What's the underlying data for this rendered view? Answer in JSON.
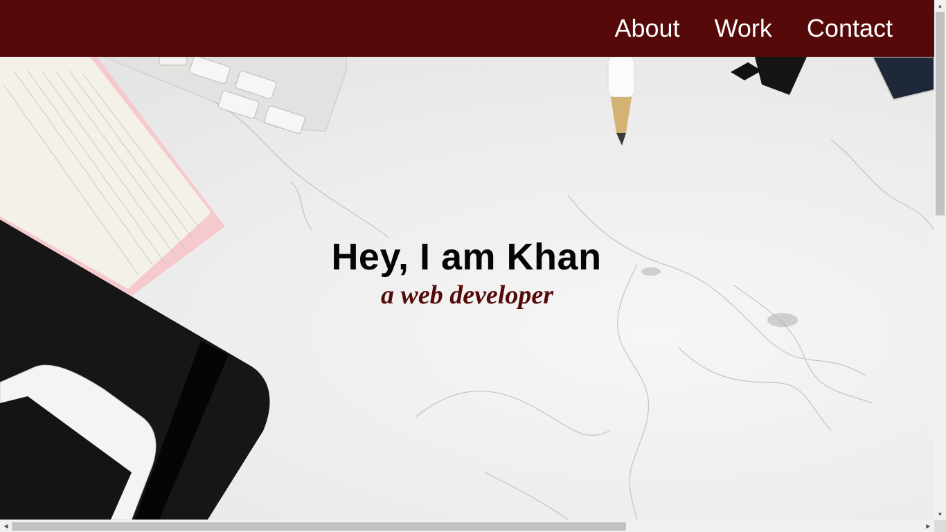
{
  "nav": {
    "links": [
      {
        "label": "About"
      },
      {
        "label": "Work"
      },
      {
        "label": "Contact"
      }
    ]
  },
  "hero": {
    "title": "Hey, I am Khan",
    "subtitle": "a web developer",
    "background": "marble desk with keyboard, notebook, pen, phone and planner"
  },
  "colors": {
    "nav_bg": "#550909",
    "nav_text": "#ffffff",
    "title": "#050505",
    "subtitle": "#550909"
  },
  "scrollbars": {
    "vertical": {
      "position_fraction": 0.0,
      "visible_fraction": 0.42
    },
    "horizontal": {
      "position_fraction": 0.0,
      "visible_fraction": 0.67
    }
  },
  "icons": {
    "scroll_up": "chevron-up-icon",
    "scroll_down": "chevron-down-icon",
    "scroll_left": "chevron-left-icon",
    "scroll_right": "chevron-right-icon"
  }
}
